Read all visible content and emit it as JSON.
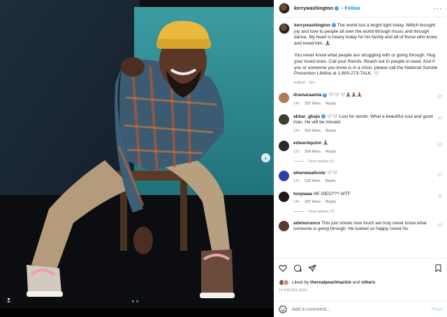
{
  "post": {
    "author": "kerrywashington",
    "follow_label": "Follow",
    "separator": "•",
    "more_label": "···"
  },
  "caption": {
    "author": "kerrywashington",
    "text": "The world lost a bright light today. tWitch brought joy and love to people all over the world through music and through dance. My heart is heavy today for his family and all of those who knew and loved him. 🙏🏾",
    "text2": "You never know what people are struggling with or going through. Hug your loved ones. Call your friends. Reach out to people in need. And if you or someone you know is in a crisis. please call the National Suicide Prevention Lifeline at 1-800-273-TALK. 🤍",
    "meta": "Edited · 12h"
  },
  "comments": [
    {
      "user": "dramaraamla",
      "text": "🤍🤍🤍🙏🏾🙏🏾🙏🏾",
      "age": "14h",
      "likes": "337 likes",
      "reply": "Reply",
      "replies": "",
      "avatar_color": "#b5775b",
      "verified": true
    },
    {
      "user": "akbar_gbaja",
      "text": "🤍🤍 Lost for words. What a beautiful soul and good man. He will be missed.",
      "age": "14h",
      "likes": "610 likes",
      "reply": "Reply",
      "replies": "",
      "avatar_color": "#3e3e2e",
      "verified": true
    },
    {
      "user": "edwardquinn",
      "text": "🙏🏾",
      "age": "12h",
      "likes": "204 likes",
      "reply": "Reply",
      "replies": "View replies (1)",
      "avatar_color": "#2a2a2a",
      "verified": false
    },
    {
      "user": "whenweallvote",
      "text": "🤍🤍",
      "age": "11h",
      "likes": "120 likes",
      "reply": "Reply",
      "replies": "",
      "avatar_color": "#2b3fa8",
      "verified": false
    },
    {
      "user": "toopiaaa",
      "text": "HE DIED??? WTF",
      "age": "14h",
      "likes": "237 likes",
      "reply": "Reply",
      "replies": "View replies (7)",
      "avatar_color": "#1a1a1a",
      "verified": false
    },
    {
      "user": "ademoravco",
      "text": "This just shows how much we truly never know what someone is going through. He looked so happy, loved his",
      "age": "",
      "likes": "",
      "reply": "",
      "replies": "",
      "avatar_color": "#5a3a2a",
      "verified": false
    }
  ],
  "likes": {
    "prefix": "Liked by",
    "user": "therealpearlmackie",
    "and": "and",
    "others": "others"
  },
  "timestamp": "14 HOURS AGO",
  "add_comment": {
    "placeholder": "Add a comment...",
    "post_label": "Post"
  },
  "colors": {
    "accent": "#0095f6",
    "verified": "#3897f0",
    "wall_teal": "#2f8d92",
    "wall_dark": "#1b2733"
  }
}
